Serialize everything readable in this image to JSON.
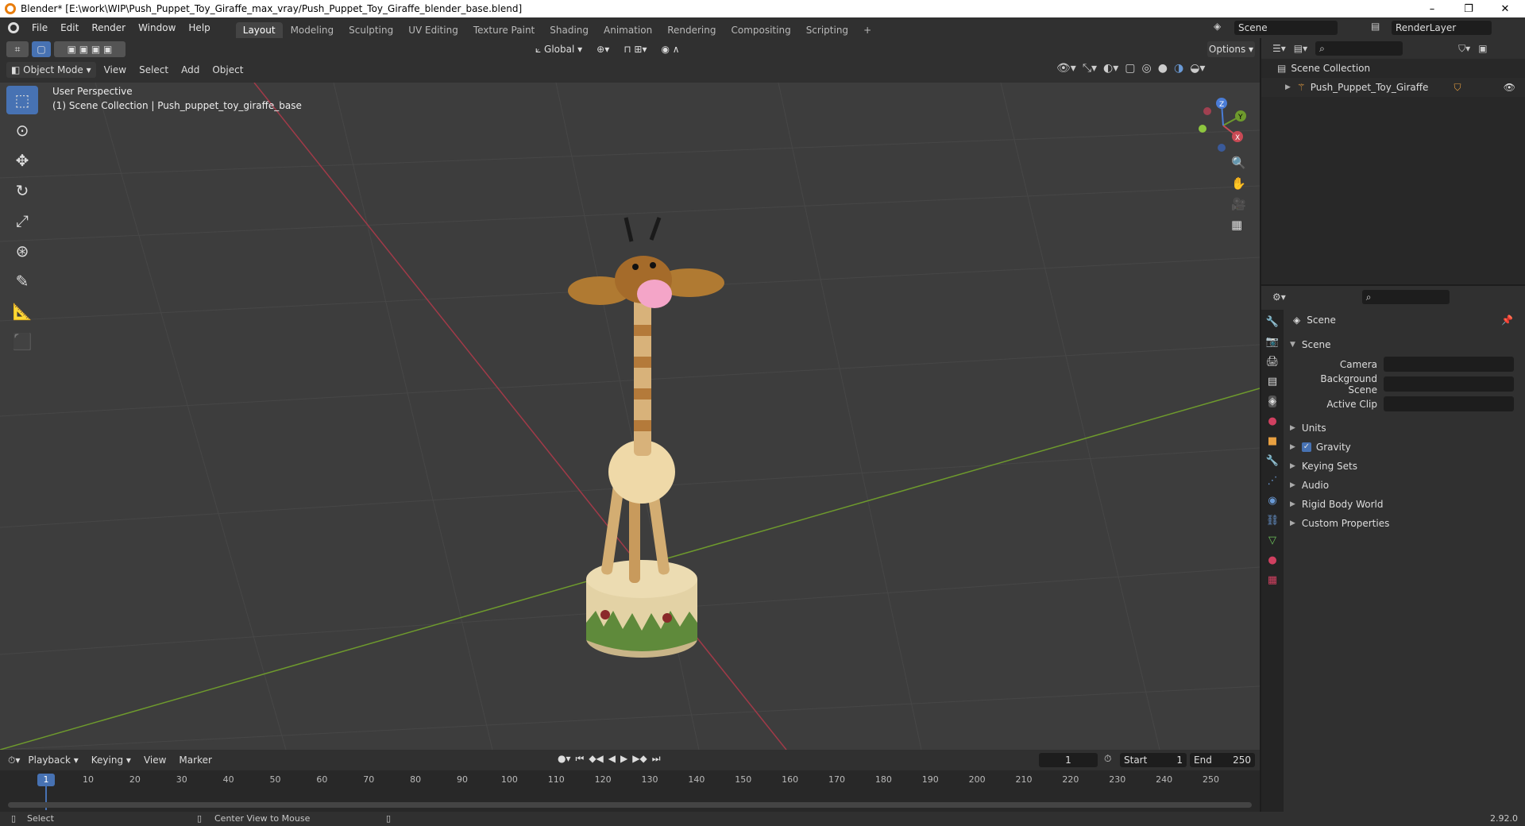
{
  "window": {
    "title": "Blender* [E:\\work\\WIP\\Push_Puppet_Toy_Giraffe_max_vray/Push_Puppet_Toy_Giraffe_blender_base.blend]",
    "min": "–",
    "max": "❐",
    "close": "✕"
  },
  "menu": [
    "File",
    "Edit",
    "Render",
    "Window",
    "Help"
  ],
  "workspaces": [
    "Layout",
    "Modeling",
    "Sculpting",
    "UV Editing",
    "Texture Paint",
    "Shading",
    "Animation",
    "Rendering",
    "Compositing",
    "Scripting"
  ],
  "add_workspace": "+",
  "scene": {
    "name": "Scene",
    "view_layer": "RenderLayer"
  },
  "viewport_header": {
    "transform": "Global",
    "options": "Options",
    "mode": "Object Mode",
    "menus": [
      "View",
      "Select",
      "Add",
      "Object"
    ]
  },
  "viewport": {
    "perspective": "User Perspective",
    "collection_info": "(1) Scene Collection | Push_puppet_toy_giraffe_base"
  },
  "gizmo": {
    "x": "X",
    "y": "Y",
    "z": "Z"
  },
  "outliner": {
    "root": "Scene Collection",
    "item": "Push_Puppet_Toy_Giraffe"
  },
  "properties": {
    "context": "Scene",
    "panel": "Scene",
    "fields": [
      {
        "label": "Camera"
      },
      {
        "label": "Background Scene"
      },
      {
        "label": "Active Clip"
      }
    ],
    "sections": [
      "Units",
      "Gravity",
      "Keying Sets",
      "Audio",
      "Rigid Body World",
      "Custom Properties"
    ],
    "gravity_checked": true
  },
  "timeline": {
    "menus": [
      "Playback",
      "Keying",
      "View",
      "Marker"
    ],
    "current_frame": "1",
    "start_label": "Start",
    "start": "1",
    "end_label": "End",
    "end": "250",
    "ticks": [
      "1",
      "10",
      "20",
      "30",
      "40",
      "50",
      "60",
      "70",
      "80",
      "90",
      "100",
      "110",
      "120",
      "130",
      "140",
      "150",
      "160",
      "170",
      "180",
      "190",
      "200",
      "210",
      "220",
      "230",
      "240",
      "250"
    ]
  },
  "status": {
    "left": "Select",
    "middle": "Center View to Mouse",
    "version": "2.92.0"
  }
}
